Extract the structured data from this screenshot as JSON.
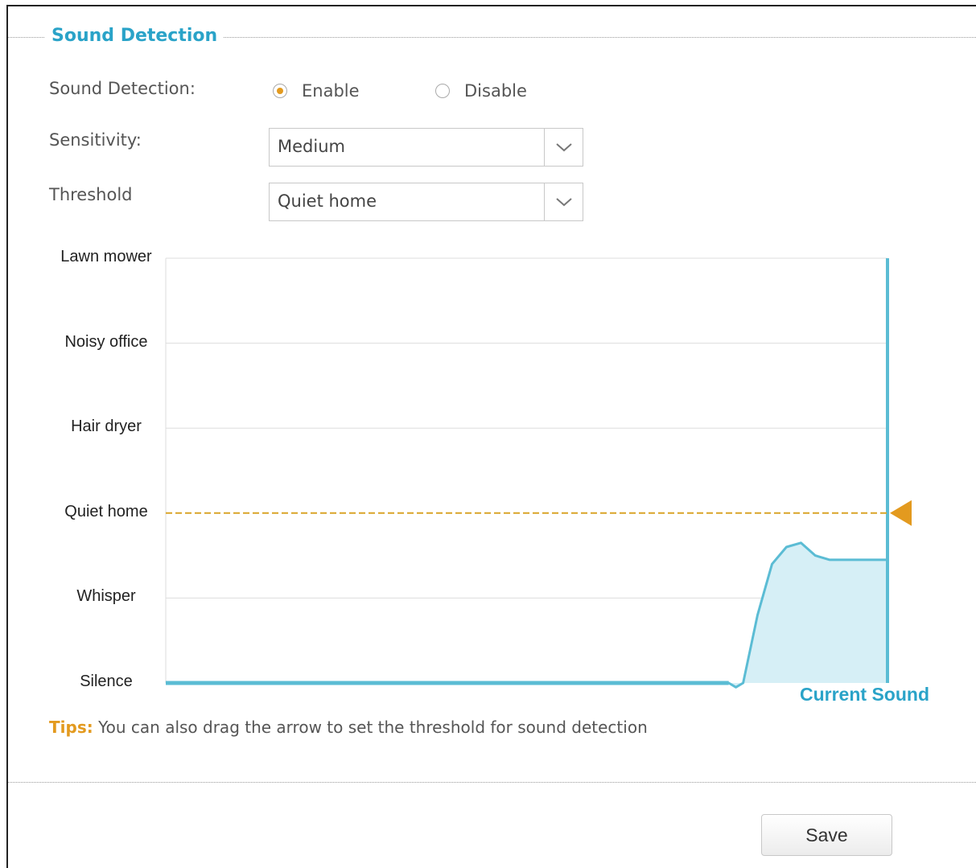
{
  "section": {
    "title": "Sound Detection"
  },
  "form": {
    "sound_detection_label": "Sound Detection:",
    "enable_label": "Enable",
    "disable_label": "Disable",
    "selected": "Enable",
    "sensitivity_label": "Sensitivity:",
    "sensitivity_value": "Medium",
    "threshold_label": "Threshold",
    "threshold_value": "Quiet home"
  },
  "chart_data": {
    "type": "area",
    "levels": [
      "Silence",
      "Whisper",
      "Quiet home",
      "Hair dryer",
      "Noisy office",
      "Lawn mower"
    ],
    "threshold_level": "Quiet home",
    "current_label": "Current Sound",
    "grid": true,
    "series": [
      {
        "x": [
          0,
          0.78,
          0.79,
          0.8,
          0.82,
          0.84,
          0.86,
          0.88,
          0.9,
          0.92,
          0.94,
          0.96,
          1.0
        ],
        "y": [
          0,
          0,
          -0.05,
          0,
          0.8,
          1.4,
          1.6,
          1.65,
          1.5,
          1.45,
          1.45,
          1.45,
          1.45
        ]
      }
    ],
    "colors": {
      "line": "#5bbcd4",
      "fill": "#d6eff6",
      "threshold": "#d9a428",
      "marker": "#e39a1f"
    }
  },
  "tips": {
    "key": "Tips:",
    "text": " You can also drag the arrow to set the threshold for sound detection"
  },
  "footer": {
    "save_label": "Save"
  }
}
